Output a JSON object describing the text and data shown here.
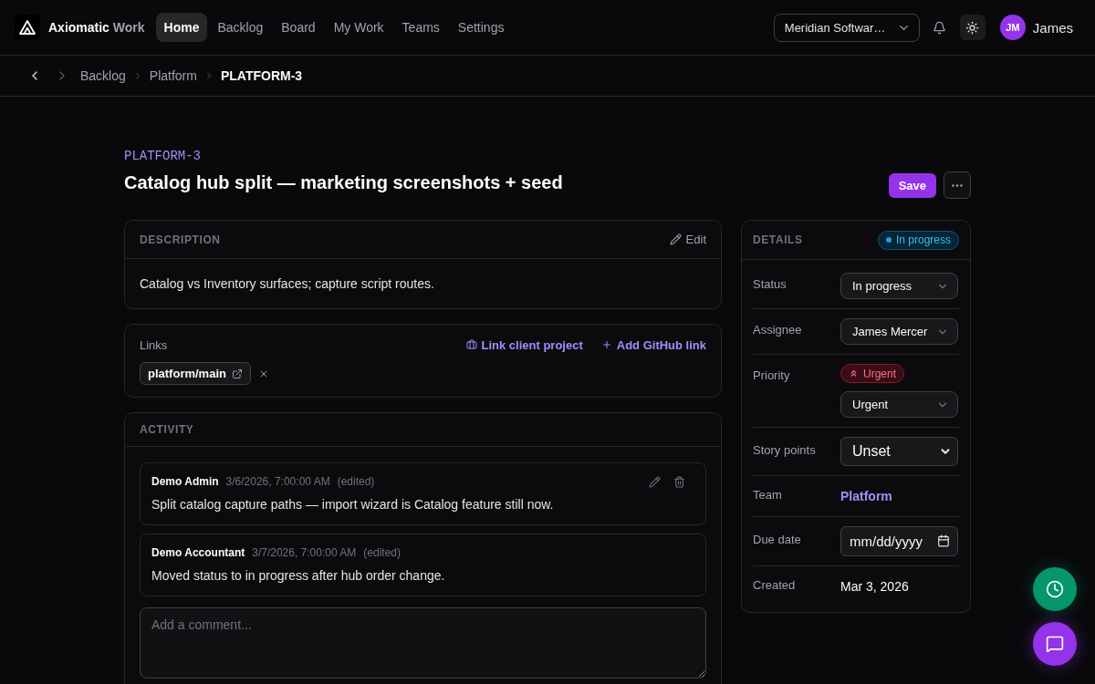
{
  "brand": {
    "name": "Axiomatic",
    "product": "Work"
  },
  "nav": [
    {
      "label": "Home",
      "selected": true
    },
    {
      "label": "Backlog",
      "selected": false
    },
    {
      "label": "Board",
      "selected": false
    },
    {
      "label": "My Work",
      "selected": false
    },
    {
      "label": "Teams",
      "selected": false
    },
    {
      "label": "Settings",
      "selected": false
    }
  ],
  "workspace_select": {
    "value": "Meridian Softwar…"
  },
  "user": {
    "initials": "JM",
    "name": "James"
  },
  "history": {
    "back_disabled": false,
    "forward_disabled": true
  },
  "breadcrumb": [
    {
      "label": "Backlog",
      "current": false
    },
    {
      "label": "Platform",
      "current": false
    },
    {
      "label": "PLATFORM-3",
      "current": true
    }
  ],
  "issue": {
    "key": "PLATFORM-3",
    "title": "Catalog hub split — marketing screenshots + seed",
    "save_label": "Save"
  },
  "description": {
    "heading": "DESCRIPTION",
    "edit_label": "Edit",
    "text": "Catalog vs Inventory surfaces; capture script routes."
  },
  "links": {
    "heading": "Links",
    "actions": [
      {
        "kind": "project",
        "label": "Link client project"
      },
      {
        "kind": "add",
        "label": "Add GitHub link"
      }
    ],
    "items": [
      {
        "label": "platform/main"
      }
    ]
  },
  "activity": {
    "heading": "ACTIVITY",
    "comments": [
      {
        "author": "Demo Admin",
        "time": "3/6/2026, 7:00:00 AM",
        "note": "(edited)",
        "text": "Split catalog capture paths — import wizard is Catalog feature still now.",
        "editable": true
      },
      {
        "author": "Demo Accountant",
        "time": "3/7/2026, 7:00:00 AM",
        "note": "(edited)",
        "text": "Moved status to in progress after hub order change.",
        "editable": false
      }
    ],
    "comment_box": {
      "placeholder": "Add a comment..."
    }
  },
  "details": {
    "heading": "DETAILS",
    "status_badge": "In progress",
    "rows": [
      {
        "kind": "select",
        "label": "Status",
        "value": "In progress"
      },
      {
        "kind": "select",
        "label": "Assignee",
        "value": "James Mercer"
      },
      {
        "kind": "priority",
        "label": "Priority",
        "badge": "Urgent",
        "value": "Urgent"
      },
      {
        "kind": "native_select",
        "label": "Story points",
        "value": "Unset"
      },
      {
        "kind": "link",
        "label": "Team",
        "value": "Platform"
      },
      {
        "kind": "date",
        "label": "Due date",
        "placeholder": "mm/dd/yyyy"
      },
      {
        "kind": "text",
        "label": "Created",
        "value": "Mar 3, 2026"
      }
    ]
  }
}
